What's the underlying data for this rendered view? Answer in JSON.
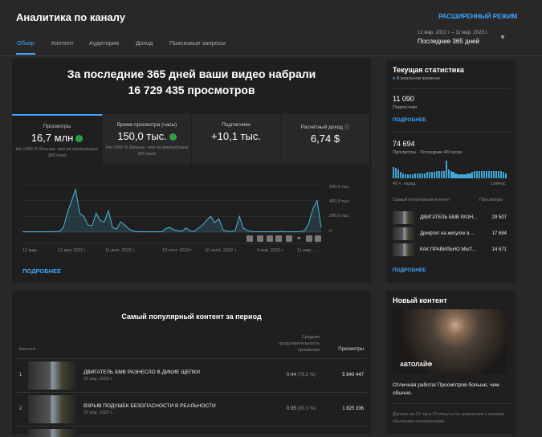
{
  "header": {
    "title": "Аналитика по каналу",
    "advanced_mode": "РАСШИРЕННЫЙ РЕЖИМ",
    "tabs": [
      "Обзор",
      "Контент",
      "Аудитория",
      "Доход",
      "Поисковые запросы"
    ],
    "date_range": "12 мар. 2022 г. – 11 мар. 2023 г.",
    "period": "Последние 365 дней"
  },
  "overview": {
    "headline_1": "За последние 365 дней ваши видео набрали",
    "headline_2": "16 729 435 просмотров",
    "metrics": [
      {
        "label": "Просмотры",
        "value": "16,7 млн",
        "note": "На >999 % больше, чем за предыдущие 365 дней"
      },
      {
        "label": "Время просмотра (часы)",
        "value": "150,0 тыс.",
        "note": "На >999 % больше, чем за предыдущие 365 дней"
      },
      {
        "label": "Подписчики",
        "value": "+10,1 тыс.",
        "note": ""
      },
      {
        "label": "Расчетный доход",
        "value": "6,74 $",
        "note": ""
      }
    ],
    "more": "ПОДРОБНЕЕ"
  },
  "chart_data": {
    "type": "area",
    "title": "Просмотры",
    "x_unit": "days since 12 мар. 2022",
    "x_step": 5,
    "x_start": 0,
    "values": [
      5,
      5,
      5,
      5,
      5,
      5,
      6,
      6,
      8,
      10,
      60,
      250,
      400,
      540,
      240,
      200,
      90,
      80,
      240,
      150,
      130,
      270,
      60,
      40,
      130,
      90,
      40,
      15,
      8,
      5,
      5,
      5,
      5,
      5,
      5,
      45,
      60,
      30,
      20,
      10,
      55,
      15,
      10,
      50,
      90,
      150,
      200,
      120,
      170,
      30,
      10,
      10,
      20,
      200,
      50,
      20,
      8,
      5,
      5,
      5,
      5,
      5,
      5,
      10,
      8,
      5,
      5,
      5,
      6,
      20,
      120,
      300,
      400,
      60
    ],
    "ylim": [
      0,
      600
    ],
    "y_ticks": [
      "600,0 тыс.",
      "400,0 тыс.",
      "200,0 тыс.",
      "0"
    ],
    "x_ticks": [
      "12 мар. ...",
      "12 мая 2022 г.",
      "11 июл. 2022 г.",
      "10 сент. 2022 г.",
      "10 нояб. 2022 г.",
      "9 янв. 2023 г.",
      "11 мар. ..."
    ],
    "grid": true
  },
  "top_content": {
    "title": "Самый популярный контент за период",
    "col_content": "Контент",
    "col_avg": "Средняя продолжительность просмотра",
    "col_views": "Просмотры",
    "rows": [
      {
        "rank": "1",
        "title": "ДВИГАТЕЛЬ БМВ РАЗНЕСЛО В ДИКИЕ ЩЕПКИ",
        "date": "22 апр. 2022 г.",
        "avg": "0:44",
        "pct": "(76,5 %)",
        "views": "5 840 447"
      },
      {
        "rank": "2",
        "title": "ВЗРЫВ ПОДУШЕК БЕЗОПАСНОСТИ В РЕАЛЬНОСТИ",
        "date": "22 апр. 2022 г.",
        "avg": "0:35",
        "pct": "(80,3 %)",
        "views": "1 825 336"
      }
    ]
  },
  "realtime": {
    "title": "Текущая статистика",
    "live": "В реальном времени",
    "subs": "11 090",
    "subs_label": "Подписчики",
    "more": "ПОДРОБНЕЕ",
    "views": "74 694",
    "views_label": "Просмотры · Последние 48 часов",
    "bars": [
      9,
      8,
      7,
      5,
      4,
      3,
      3,
      3,
      3,
      4,
      4,
      4,
      4,
      4,
      5,
      5,
      5,
      5,
      6,
      6,
      6,
      6,
      14,
      7,
      6,
      5,
      4,
      3,
      3,
      3,
      3,
      4,
      4,
      5,
      6,
      6,
      6,
      6,
      6,
      6,
      6,
      6,
      6,
      6,
      6,
      6,
      5,
      4
    ],
    "ago": "48 ч. назад",
    "now": "Сейчас",
    "top_label": "Самый популярный контент",
    "top_views_label": "Просмотры",
    "top": [
      {
        "title": "ДВИГАТЕЛЬ БМВ РАЗН...",
        "views": "29 507"
      },
      {
        "title": "Дрифтит на жигулях в ...",
        "views": "17 684"
      },
      {
        "title": "КАК ПРАВИЛЬНО МЫТ...",
        "views": "14 671"
      }
    ],
    "more2": "ПОДРОБНЕЕ"
  },
  "new_content": {
    "title": "Новый контент",
    "thumb_text": "АВТОЛАЙФ",
    "message": "Отличная работа! Просмотров больше, чем обычно.",
    "footer": "Данные за 23 часа 23 минуты по сравнению с вашими обычными показателями"
  },
  "colors": {
    "accent": "#3ea6ff",
    "line": "#4fb3d9",
    "up": "#2ba640"
  }
}
